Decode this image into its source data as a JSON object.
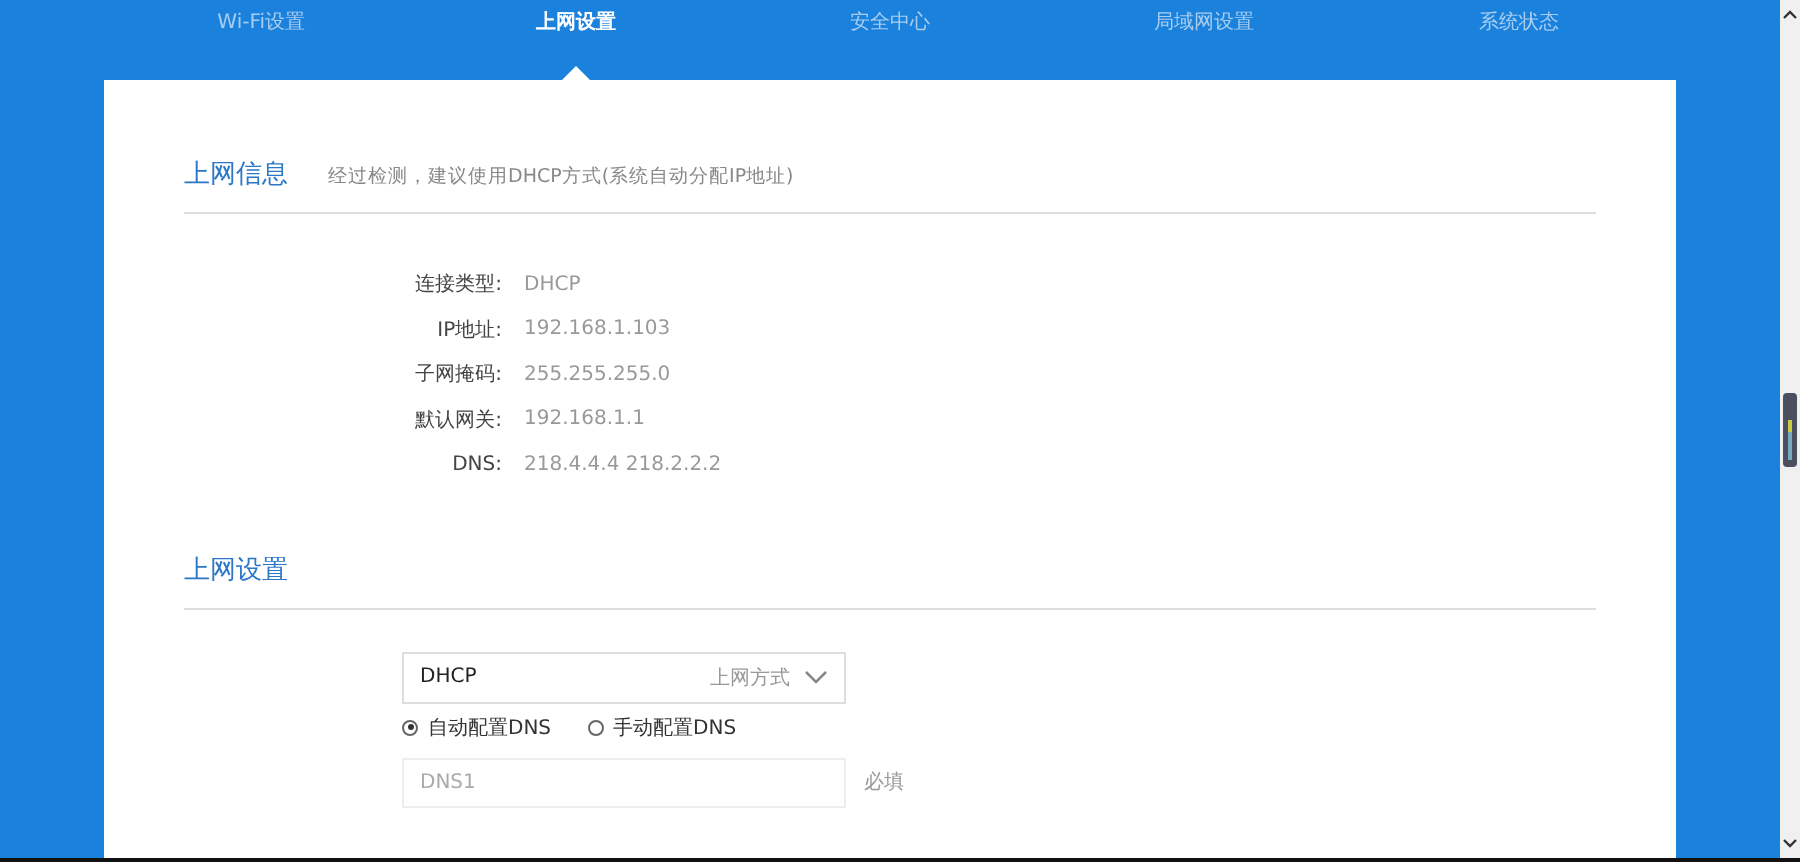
{
  "tabs": [
    {
      "label": "Wi-Fi设置",
      "selected": false
    },
    {
      "label": "上网设置",
      "selected": true
    },
    {
      "label": "安全中心",
      "selected": false
    },
    {
      "label": "局域网设置",
      "selected": false
    },
    {
      "label": "系统状态",
      "selected": false
    }
  ],
  "info": {
    "title": "上网信息",
    "hint": "经过检测，建议使用DHCP方式(系统自动分配IP地址)",
    "rows": [
      {
        "label": "连接类型:",
        "value": "DHCP"
      },
      {
        "label": "IP地址:",
        "value": "192.168.1.103"
      },
      {
        "label": "子网掩码:",
        "value": "255.255.255.0"
      },
      {
        "label": "默认网关:",
        "value": "192.168.1.1"
      },
      {
        "label": "DNS:",
        "value": "218.4.4.4 218.2.2.2"
      }
    ]
  },
  "settings": {
    "title": "上网设置",
    "mode": {
      "value": "DHCP",
      "label": "上网方式"
    },
    "dns_options": [
      {
        "label": "自动配置DNS",
        "selected": true
      },
      {
        "label": "手动配置DNS",
        "selected": false
      }
    ],
    "dns1": {
      "placeholder": "DNS1",
      "note": "必填"
    }
  }
}
